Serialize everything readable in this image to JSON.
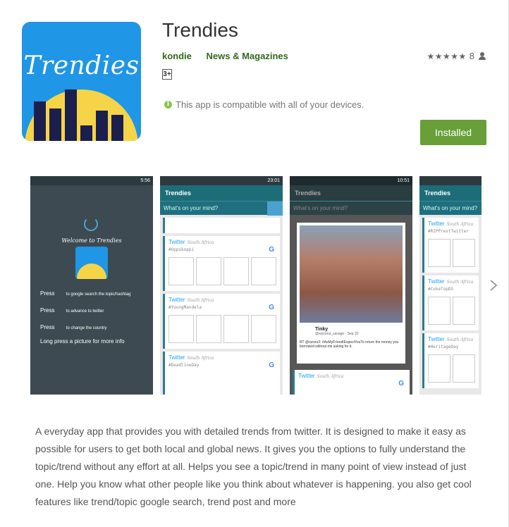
{
  "app": {
    "title": "Trendies",
    "developer": "kondie",
    "category": "News & Magazines",
    "content_rating": "3+",
    "rating_stars": 5,
    "rating_count": "8",
    "compatibility": "This app is compatible with all of your devices.",
    "install_label": "Installed",
    "icon_text": "Trendies"
  },
  "colors": {
    "accent": "#689f38",
    "link": "#33691e",
    "icon_blue": "#1f96e6",
    "icon_yellow": "#f5d547",
    "icon_bars": "#1b1f4d"
  },
  "screenshots": {
    "s1": {
      "status_time": "5:56",
      "welcome": "Welcome to Trendies",
      "mini_logo": "Trendies",
      "press1": "Press",
      "press1_hint": "to google search the topic/hashtag",
      "press2": "Press",
      "press2_hint": "to advance to twitter",
      "press3": "Press",
      "press3_hint": "to change the country",
      "long_press": "Long press a picture for more info"
    },
    "s2": {
      "status_time": "23:01",
      "appbar": "Trendies",
      "search_placeholder": "What's on your mind?",
      "cards": [
        {
          "source": "Twitter",
          "region": "South Africa",
          "tag": "#Oppskoppi"
        },
        {
          "source": "Twitter",
          "region": "South Africa",
          "tag": "#YoungMandela"
        },
        {
          "source": "Twitter",
          "region": "South Africa",
          "tag": "#DeadlineDay"
        }
      ]
    },
    "s3": {
      "status_time": "10:51",
      "appbar": "Trendies",
      "search_placeholder": "What's on your mind?",
      "tweet_user": "Tinky",
      "tweet_handle": "@wynona_savage · Sep 20",
      "tweet_text": "RT @ozozo3: #AsMyFriendIExpectYouTo return the money you borrowed without me asking for it.",
      "card_source": "Twitter",
      "card_region": "South Africa"
    },
    "s4": {
      "appbar": "Trendies",
      "search_placeholder": "What's on your mind?",
      "cards": [
        {
          "source": "Twitter",
          "region": "South Africa",
          "tag": "#RIPPrestTwitter"
        },
        {
          "source": "Twitter",
          "region": "South Africa",
          "tag": "#CokeTopDS"
        },
        {
          "source": "Twitter",
          "region": "South Africa",
          "tag": "#HeritageDay"
        }
      ]
    }
  },
  "description": "A everyday app that provides you with detailed trends from twitter. It is designed to make it easy as possible for users to get both local and global news. It gives you the options to fully understand the topic/trend without any effort at all. Helps you see a topic/trend in many point of view instead of just one. Help you know what other people like you think about whatever is happening. you also get cool features like trend/topic google search, trend post and more"
}
